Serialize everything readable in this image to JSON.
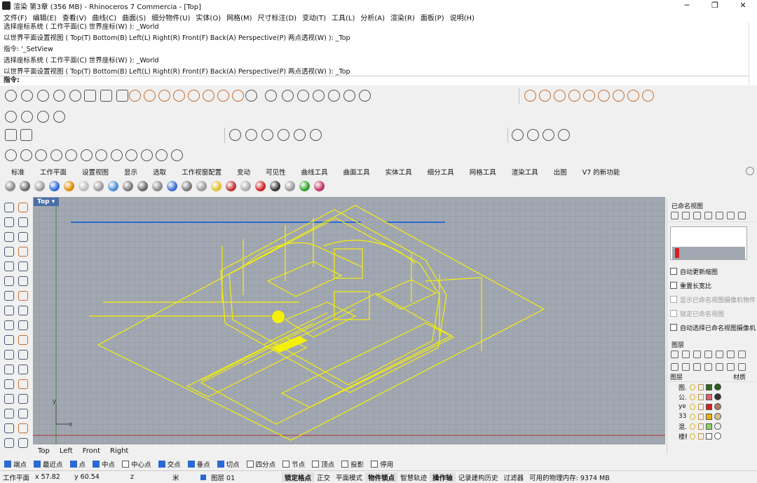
{
  "title": "渲染 第3章 (356 MB) - Rhinoceros 7 Commercia - [Top]",
  "window_controls": [
    "─",
    "❐",
    "✕"
  ],
  "menu": [
    "文件(F)",
    "编辑(E)",
    "查看(V)",
    "曲线(C)",
    "曲面(S)",
    "细分物件(U)",
    "实体(O)",
    "网格(M)",
    "尺寸标注(D)",
    "变动(T)",
    "工具(L)",
    "分析(A)",
    "渲染(R)",
    "面板(P)",
    "说明(H)"
  ],
  "command_history": [
    "选择座标系统 ( 工作平面(C)  世界座标(W) ): _World",
    "以世界平面设置视图 ( Top(T)  Bottom(B)  Left(L)  Right(R)  Front(F)  Back(A)  Perspective(P)  两点透视(W) ): _Top",
    "指令: '_SetView",
    "选择座标系统 ( 工作平面(C)  世界座标(W) ): _World",
    "以世界平面设置视图 ( Top(T)  Bottom(B)  Left(L)  Right(R)  Front(F)  Back(A)  Perspective(P)  两点透视(W) ): _Top"
  ],
  "command_prompt": "指令:",
  "toolbar_tabs": [
    "标准",
    "工作平面",
    "设置视图",
    "显示",
    "选取",
    "工作视窗配置",
    "变动",
    "可见性",
    "曲线工具",
    "曲面工具",
    "实体工具",
    "细分工具",
    "网格工具",
    "渲染工具",
    "出图",
    "V7 的新功能"
  ],
  "viewport": {
    "name": "Top",
    "axis_x": "x",
    "axis_y": "y"
  },
  "viewport_tabs": [
    "Top",
    "Left",
    "Front",
    "Right"
  ],
  "named_views": {
    "title": "已命名视图",
    "options": [
      {
        "label": "自动更新缩图",
        "enabled": true
      },
      {
        "label": "重置长宽比",
        "enabled": true
      },
      {
        "label": "显示已命名视图摄像机物件",
        "enabled": false
      },
      {
        "label": "锁定已命名视图",
        "enabled": false
      },
      {
        "label": "自动选择已命名视图摄像机",
        "enabled": true
      }
    ]
  },
  "layers": {
    "title": "图层",
    "col_layer": "图层",
    "col_material": "材质",
    "rows": [
      {
        "name": "图...",
        "color": "#2d6b1e",
        "mat": "#2a5c1c"
      },
      {
        "name": "公...",
        "color": "#e06070",
        "mat": "#333333"
      },
      {
        "name": "ye",
        "color": "#d42020",
        "mat": "#b07860"
      },
      {
        "name": "33",
        "color": "#f0b000",
        "mat": "#d4c08a"
      },
      {
        "name": "混...",
        "color": "#90d060",
        "mat": "#f0f0f0"
      },
      {
        "name": "楼板",
        "color": "#ffffff",
        "mat": "#ffffff"
      }
    ]
  },
  "osnap": [
    {
      "label": "端点",
      "on": true
    },
    {
      "label": "最近点",
      "on": true
    },
    {
      "label": "点",
      "on": true
    },
    {
      "label": "中点",
      "on": true
    },
    {
      "label": "中心点",
      "on": false
    },
    {
      "label": "交点",
      "on": true
    },
    {
      "label": "垂点",
      "on": true
    },
    {
      "label": "切点",
      "on": true
    },
    {
      "label": "四分点",
      "on": false
    },
    {
      "label": "节点",
      "on": false
    },
    {
      "label": "顶点",
      "on": false
    },
    {
      "label": "投影",
      "on": false
    },
    {
      "label": "停用",
      "on": false
    }
  ],
  "status": {
    "cplane": "工作平面",
    "x": "x 57.82",
    "y": "y 60.54",
    "z": "z",
    "units": "米",
    "layer": "图层 01",
    "items": [
      "锁定格点",
      "正交",
      "平面模式",
      "物件锁点",
      "智慧轨迹",
      "操作轴",
      "记录建构历史",
      "过滤器",
      "可用的物理内存: 9374 MB"
    ],
    "bold_items": [
      true,
      false,
      false,
      true,
      false,
      true,
      false,
      false,
      false
    ]
  },
  "colors": {
    "viewport_bg": "#a2a8b1",
    "wire": "#f5f00a",
    "blue_line": "#2a6ad3"
  }
}
